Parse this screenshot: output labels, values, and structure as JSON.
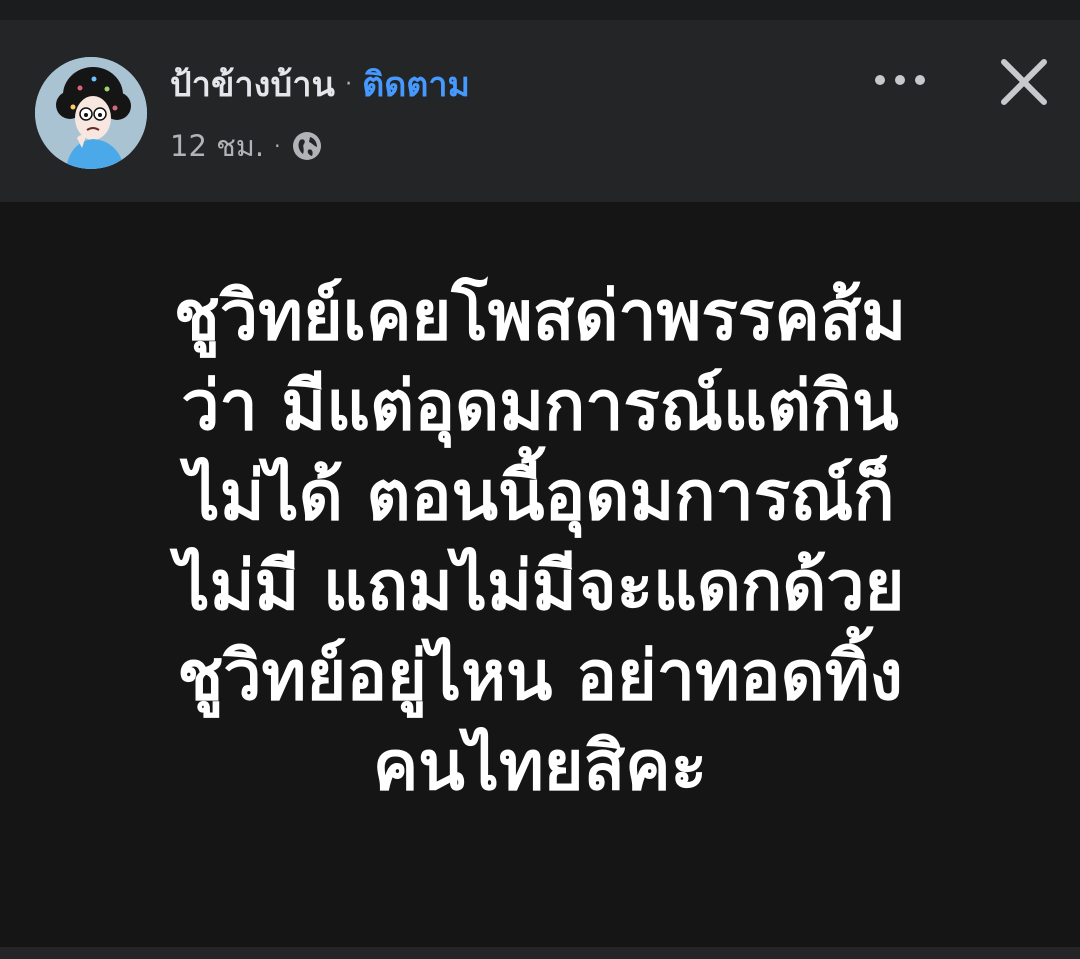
{
  "post": {
    "author": {
      "name": "ป้าข้างบ้าน",
      "avatar_icon": "cartoon-woman-avatar"
    },
    "separator": "·",
    "follow_label": "ติดตาม",
    "time": "12 ชม.",
    "privacy_icon": "globe-icon",
    "more_icon": "more-dots-icon",
    "close_icon": "close-icon",
    "text_lines": [
      "ชูวิทย์เคยโพสด่าพรรคส้ม",
      "ว่า มีแต่อุดมการณ์แต่กิน",
      "ไม่ได้ ตอนนี้อุดมการณ์ก็",
      "ไม่มี แถมไม่มีจะแดกด้วย",
      "ชูวิทย์อยู่ไหน อย่าทอดทิ้ง",
      "คนไทยสิคะ"
    ]
  },
  "colors": {
    "header_bg": "#242526",
    "post_bg": "#151515",
    "follow_link": "#4599ff",
    "secondary_text": "#b0b3b8",
    "primary_text": "#e4e6eb"
  }
}
